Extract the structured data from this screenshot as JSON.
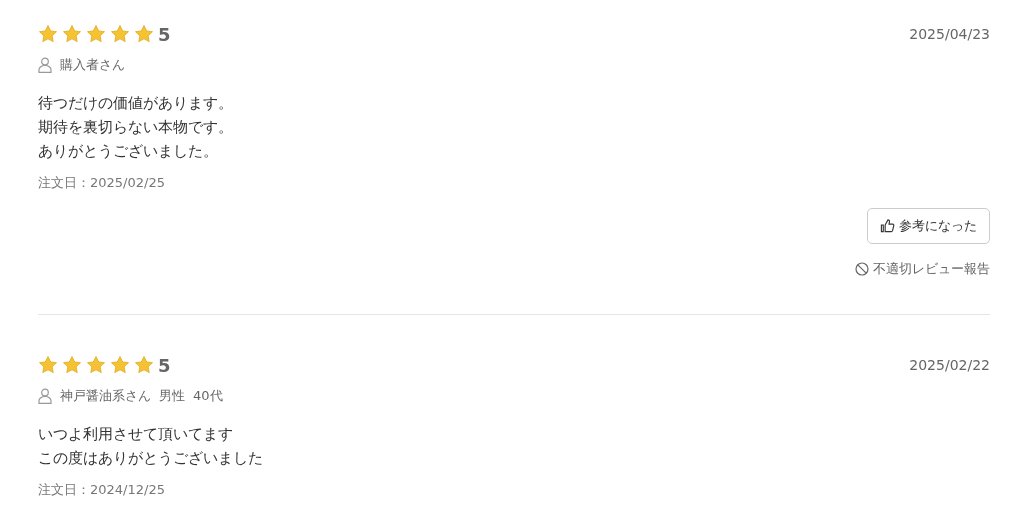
{
  "reviews": [
    {
      "stars": 5,
      "rating": "5",
      "date": "2025/04/23",
      "reviewer": {
        "name": "購入者さん"
      },
      "body": [
        "待つだけの価値があります。",
        "期待を裏切らない本物です。",
        "ありがとうございました。"
      ],
      "order_date": "注文日：2025/02/25",
      "helpful_button": "参考になった",
      "report_link": "不適切レビュー報告"
    },
    {
      "stars": 5,
      "rating": "5",
      "date": "2025/02/22",
      "reviewer": {
        "name": "神戸醤油系さん",
        "gender": "男性",
        "age": "40代"
      },
      "body": [
        "いつよ利用させて頂いてます",
        "この度はありがとうございました"
      ],
      "order_date": "注文日：2024/12/25"
    }
  ]
}
